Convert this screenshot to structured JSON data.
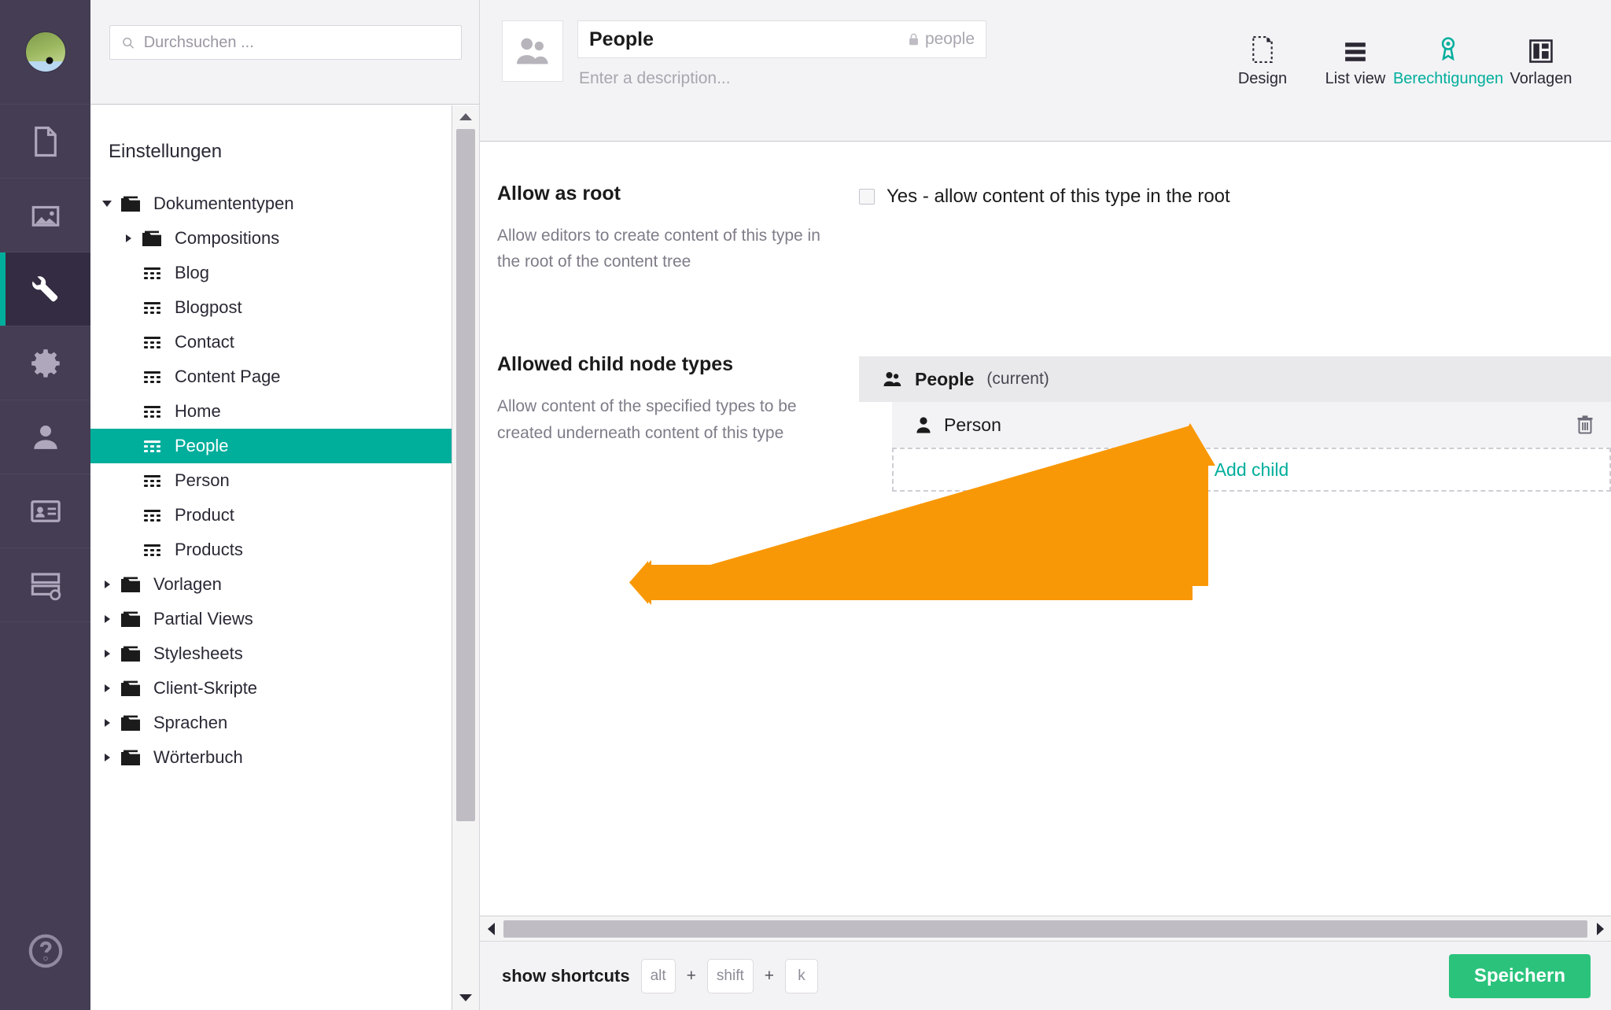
{
  "colors": {
    "rail_bg": "#443D54",
    "accent_teal": "#00AE9C",
    "save_green": "#2BC37C",
    "annotation_orange": "#F99806",
    "selected_tree": "#00AE9C"
  },
  "rail": {
    "avatar": "user-avatar",
    "items": [
      {
        "name": "content-section",
        "icon": "document-icon",
        "active": false
      },
      {
        "name": "media-section",
        "icon": "image-icon",
        "active": false
      },
      {
        "name": "settings-section",
        "icon": "wrench-icon",
        "active": true
      },
      {
        "name": "packages-section",
        "icon": "gear-icon",
        "active": false
      },
      {
        "name": "users-section",
        "icon": "user-icon",
        "active": false
      },
      {
        "name": "members-section",
        "icon": "id-card-icon",
        "active": false
      },
      {
        "name": "forms-section",
        "icon": "forms-icon",
        "active": false
      }
    ],
    "help": {
      "name": "help-button",
      "icon": "question-circle-icon"
    }
  },
  "search": {
    "placeholder": "Durchsuchen ...",
    "value": "",
    "icon": "search-icon"
  },
  "tree": {
    "heading": "Einstellungen",
    "items": [
      {
        "label": "Dokumententypen",
        "icon": "folder-icon",
        "indent": 1,
        "caret": "open",
        "selected": false
      },
      {
        "label": "Compositions",
        "icon": "folder-icon",
        "indent": 2,
        "caret": "closed",
        "selected": false
      },
      {
        "label": "Blog",
        "icon": "doctype-icon",
        "indent": 2,
        "caret": "none",
        "selected": false
      },
      {
        "label": "Blogpost",
        "icon": "doctype-icon",
        "indent": 2,
        "caret": "none",
        "selected": false
      },
      {
        "label": "Contact",
        "icon": "doctype-icon",
        "indent": 2,
        "caret": "none",
        "selected": false
      },
      {
        "label": "Content Page",
        "icon": "doctype-icon",
        "indent": 2,
        "caret": "none",
        "selected": false
      },
      {
        "label": "Home",
        "icon": "doctype-icon",
        "indent": 2,
        "caret": "none",
        "selected": false
      },
      {
        "label": "People",
        "icon": "doctype-icon",
        "indent": 2,
        "caret": "none",
        "selected": true
      },
      {
        "label": "Person",
        "icon": "doctype-icon",
        "indent": 2,
        "caret": "none",
        "selected": false
      },
      {
        "label": "Product",
        "icon": "doctype-icon",
        "indent": 2,
        "caret": "none",
        "selected": false
      },
      {
        "label": "Products",
        "icon": "doctype-icon",
        "indent": 2,
        "caret": "none",
        "selected": false
      },
      {
        "label": "Vorlagen",
        "icon": "folder-icon",
        "indent": 1,
        "caret": "closed",
        "selected": false
      },
      {
        "label": "Partial Views",
        "icon": "folder-icon",
        "indent": 1,
        "caret": "closed",
        "selected": false
      },
      {
        "label": "Stylesheets",
        "icon": "folder-icon",
        "indent": 1,
        "caret": "closed",
        "selected": false
      },
      {
        "label": "Client-Skripte",
        "icon": "folder-icon",
        "indent": 1,
        "caret": "closed",
        "selected": false
      },
      {
        "label": "Sprachen",
        "icon": "folder-icon",
        "indent": 1,
        "caret": "closed",
        "selected": false
      },
      {
        "label": "Wörterbuch",
        "icon": "folder-icon",
        "indent": 1,
        "caret": "closed",
        "selected": false
      }
    ]
  },
  "header": {
    "doc_icon": "people-group-icon",
    "title": "People",
    "alias": "people",
    "alias_icon": "lock-icon",
    "description_placeholder": "Enter a description...",
    "tabs": [
      {
        "label": "Design",
        "icon": "design-page-icon",
        "active": false
      },
      {
        "label": "List view",
        "icon": "list-view-icon",
        "active": false
      },
      {
        "label": "Berechtigungen",
        "icon": "permissions-icon",
        "active": true
      },
      {
        "label": "Vorlagen",
        "icon": "templates-icon",
        "active": false
      }
    ]
  },
  "content": {
    "allow_as_root": {
      "title": "Allow as root",
      "description": "Allow editors to create content of this type in the root of the content tree",
      "checkbox_label": "Yes - allow content of this type in the root",
      "checked": false
    },
    "allowed_child_types": {
      "title": "Allowed child node types",
      "description": "Allow content of the specified types to be created underneath content of this type",
      "current_node": {
        "name": "People",
        "suffix": "(current)",
        "icon": "people-group-icon"
      },
      "children": [
        {
          "name": "Person",
          "icon": "person-icon",
          "delete_icon": "trash-icon"
        }
      ],
      "add_child_label": "Add child"
    }
  },
  "footer": {
    "shortcuts_label": "show shortcuts",
    "keys": [
      "alt",
      "shift",
      "k"
    ],
    "separator": "+",
    "save_label": "Speichern"
  },
  "annotation": {
    "type": "orange-double-arrow",
    "color": "#F99806",
    "points_to": "Person child node row"
  }
}
